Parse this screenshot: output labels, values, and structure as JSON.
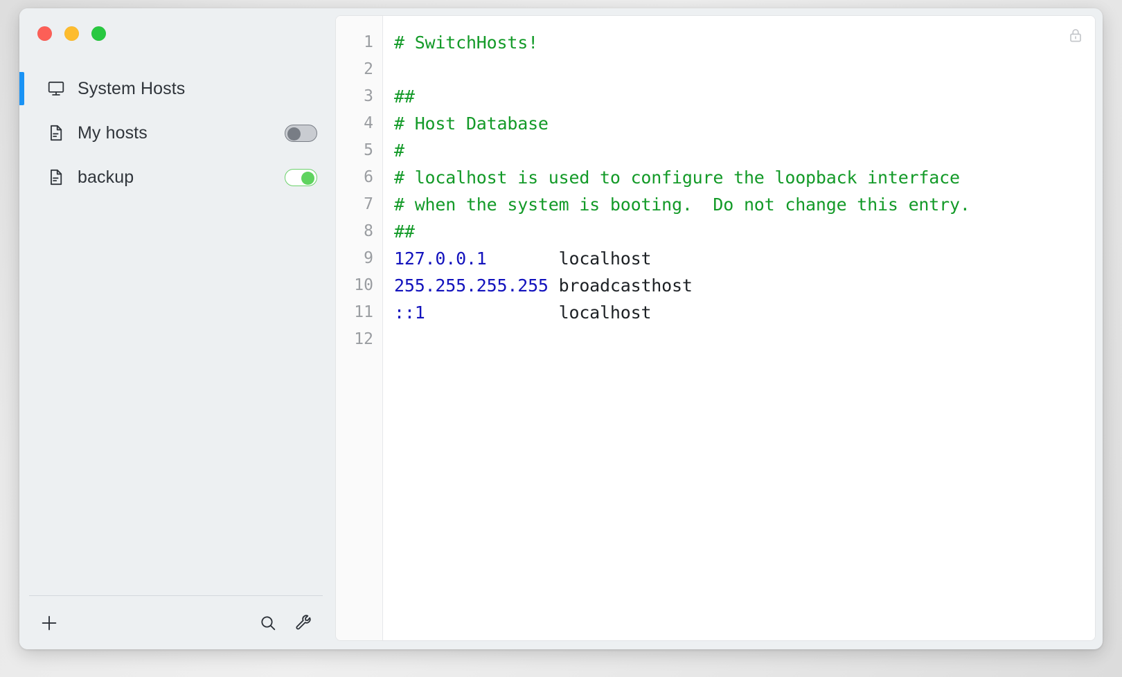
{
  "window": {
    "traffic_lights": [
      {
        "name": "close",
        "color": "#fc5f57"
      },
      {
        "name": "minimize",
        "color": "#fdbc2e"
      },
      {
        "name": "maximize",
        "color": "#28c840"
      }
    ]
  },
  "sidebar": {
    "items": [
      {
        "label": "System Hosts",
        "icon": "monitor-icon",
        "active": true,
        "has_toggle": false,
        "toggle_on": false
      },
      {
        "label": "My hosts",
        "icon": "document-icon",
        "active": false,
        "has_toggle": true,
        "toggle_on": false
      },
      {
        "label": "backup",
        "icon": "document-icon",
        "active": false,
        "has_toggle": true,
        "toggle_on": true
      }
    ],
    "footer": {
      "add_label": "+",
      "add_icon": "plus-icon",
      "search_icon": "search-icon",
      "tools_icon": "wrench-icon"
    },
    "accent_color": "#1a93f5"
  },
  "editor": {
    "lock_icon": "lock-closed-icon",
    "colors": {
      "comment": "#139a28",
      "ip": "#1313bd",
      "hostname": "#1d2125",
      "line_number": "#9a9da1"
    },
    "line_numbers": [
      "1",
      "2",
      "3",
      "4",
      "5",
      "6",
      "7",
      "8",
      "9",
      "10",
      "11",
      "12"
    ],
    "lines": [
      {
        "n": "1",
        "tokens": [
          {
            "t": "comment",
            "v": "# SwitchHosts!"
          }
        ]
      },
      {
        "n": "2",
        "tokens": []
      },
      {
        "n": "3",
        "tokens": [
          {
            "t": "comment",
            "v": "##"
          }
        ]
      },
      {
        "n": "4",
        "tokens": [
          {
            "t": "comment",
            "v": "# Host Database"
          }
        ]
      },
      {
        "n": "5",
        "tokens": [
          {
            "t": "comment",
            "v": "#"
          }
        ]
      },
      {
        "n": "6",
        "tokens": [
          {
            "t": "comment",
            "v": "# localhost is used to configure the loopback interface"
          }
        ]
      },
      {
        "n": "7",
        "tokens": [
          {
            "t": "comment",
            "v": "# when the system is booting.  Do not change this entry."
          }
        ]
      },
      {
        "n": "8",
        "tokens": [
          {
            "t": "comment",
            "v": "##"
          }
        ]
      },
      {
        "n": "9",
        "tokens": [
          {
            "t": "ip",
            "v": "127.0.0.1"
          },
          {
            "t": "host",
            "v": "       localhost"
          }
        ]
      },
      {
        "n": "10",
        "tokens": [
          {
            "t": "ip",
            "v": "255.255.255.255"
          },
          {
            "t": "host",
            "v": " broadcasthost"
          }
        ]
      },
      {
        "n": "11",
        "tokens": [
          {
            "t": "ip",
            "v": "::1"
          },
          {
            "t": "host",
            "v": "             localhost"
          }
        ]
      },
      {
        "n": "12",
        "tokens": []
      }
    ]
  }
}
